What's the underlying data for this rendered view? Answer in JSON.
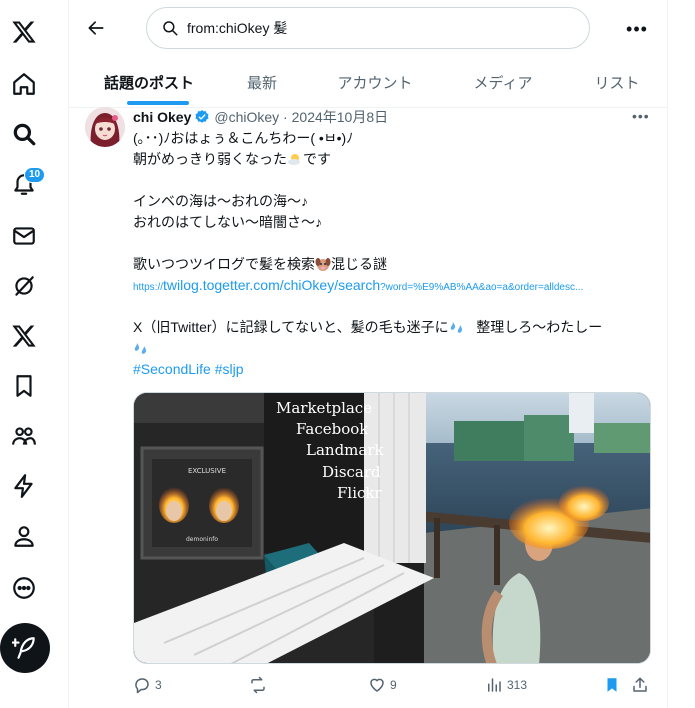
{
  "nav": {
    "notifications_badge": "10"
  },
  "search": {
    "query": "from:chiOkey 髪"
  },
  "tabs": [
    {
      "label": "話題のポスト"
    },
    {
      "label": "最新"
    },
    {
      "label": "アカウント"
    },
    {
      "label": "メディア"
    },
    {
      "label": "リスト"
    }
  ],
  "tweet": {
    "author_name": "chi Okey",
    "handle": "@chiOkey",
    "date": "2024年10月8日",
    "lines": {
      "l1": "(｡･･)ﾉおはょぅ＆こんちわー( •ㅂ•)ﾉ",
      "l2a": "朝がめっきり弱くなった",
      "l2b": "です",
      "l3": "インベの海は～おれの海～♪",
      "l4": "おれのはてしない～暗闇さ～♪",
      "l5a": "歌いつつツイログで髪を検索",
      "l5b": "混じる謎",
      "l6_link_main": "https://twilog.togetter.com/chiOkey/search",
      "l6_link_query": "?word=%E9%AB%AA&ao=a&order=alldesc...",
      "l7a": "X（旧Twitter）に記録してないと、髪の毛も迷子に",
      "l7b": "整理しろ～わたしー",
      "hashtags": "#SecondLife #sljp"
    },
    "media_signs": [
      "Marketplace",
      "Facebook",
      "Landmark",
      "Discard",
      "Flickr"
    ],
    "media_poster_label": "EXCLUSIVE",
    "media_poster_brand": "demoninfo",
    "actions": {
      "replies": "3",
      "likes": "9",
      "views": "313"
    }
  },
  "colors": {
    "accent": "#1d9bf0",
    "text": "#0f1419",
    "muted": "#536471"
  }
}
